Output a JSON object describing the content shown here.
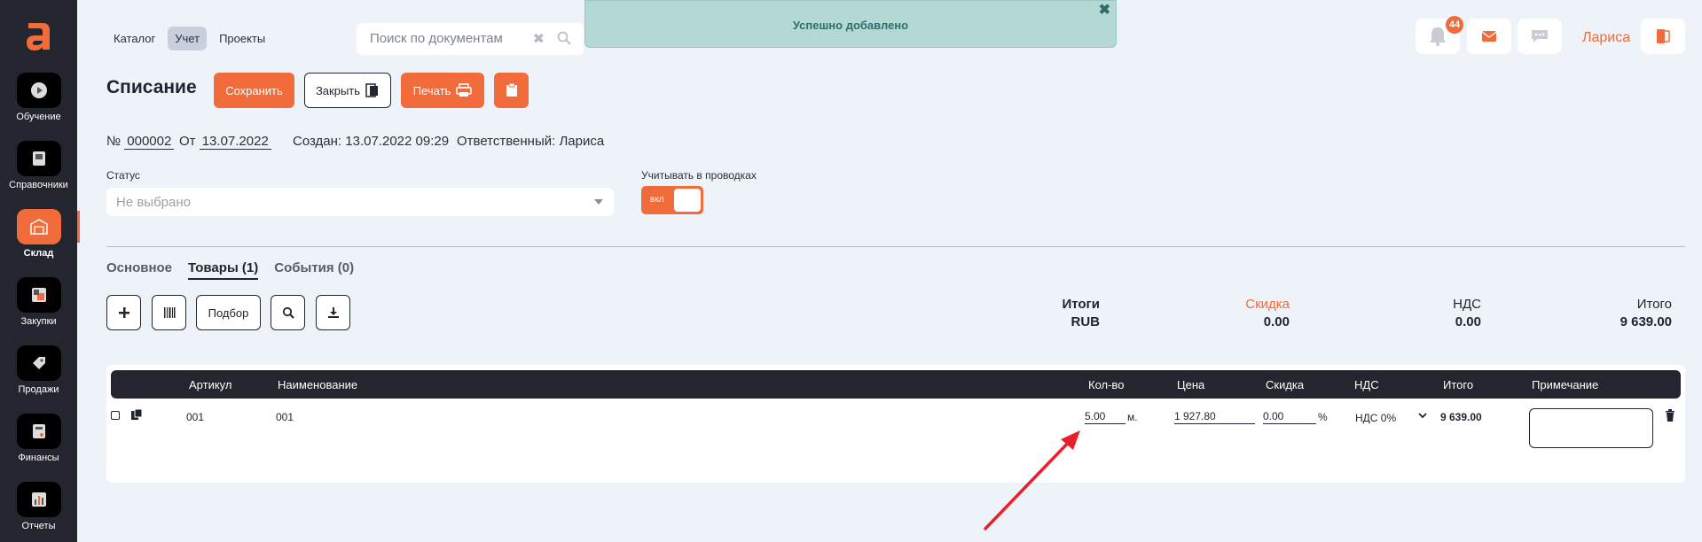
{
  "sidebar": {
    "logo_letter": "a",
    "items": [
      {
        "label": "Обучение",
        "icon": "play-icon"
      },
      {
        "label": "Справочники",
        "icon": "book-icon"
      },
      {
        "label": "Склад",
        "icon": "warehouse-icon",
        "active": true
      },
      {
        "label": "Закупки",
        "icon": "purchase-icon"
      },
      {
        "label": "Продажи",
        "icon": "tag-icon"
      },
      {
        "label": "Финансы",
        "icon": "finance-icon"
      },
      {
        "label": "Отчеты",
        "icon": "reports-icon"
      }
    ]
  },
  "topnav": {
    "catalog": "Каталог",
    "accounting": "Учет",
    "projects": "Проекты"
  },
  "search": {
    "placeholder": "Поиск по документам"
  },
  "toast": {
    "message": "Успешно добавлено"
  },
  "header": {
    "notifications_count": "44",
    "username": "Лариса"
  },
  "document": {
    "title": "Списание",
    "save_label": "Сохранить",
    "close_label": "Закрыть",
    "print_label": "Печать",
    "number_prefix": "№",
    "number": "000002",
    "date_prefix": "От",
    "date": "13.07.2022",
    "created": "Создан: 13.07.2022 09:29",
    "responsible": "Ответственный: Лариса",
    "status_label": "Статус",
    "status_placeholder": "Не выбрано",
    "posting_label": "Учитывать в проводках",
    "toggle_label": "вкл"
  },
  "tabs": [
    {
      "label": "Основное"
    },
    {
      "label": "Товары (1)",
      "active": true
    },
    {
      "label": "События (0)"
    }
  ],
  "toolbar": {
    "selection_label": "Подбор"
  },
  "totals": {
    "totals_label": "Итоги",
    "currency": "RUB",
    "discount_label": "Скидка",
    "discount_value": "0.00",
    "vat_label": "НДС",
    "vat_value": "0.00",
    "total_label": "Итого",
    "total_value": "9 639.00"
  },
  "table": {
    "columns": {
      "article": "Артикул",
      "name": "Наименование",
      "qty": "Кол-во",
      "price": "Цена",
      "discount": "Скидка",
      "vat": "НДС",
      "total": "Итого",
      "note": "Примечание"
    },
    "rows": [
      {
        "article": "001",
        "name": "001",
        "qty": "5.00",
        "unit": "м.",
        "price": "1 927.80",
        "discount": "0.00",
        "discount_unit": "%",
        "vat": "НДС 0%",
        "total": "9 639.00"
      }
    ]
  },
  "colors": {
    "accent": "#f26b3a",
    "dark": "#23262e",
    "background": "#eef2f9",
    "toast": "#b4d8d4",
    "arrow": "#e8202a"
  }
}
